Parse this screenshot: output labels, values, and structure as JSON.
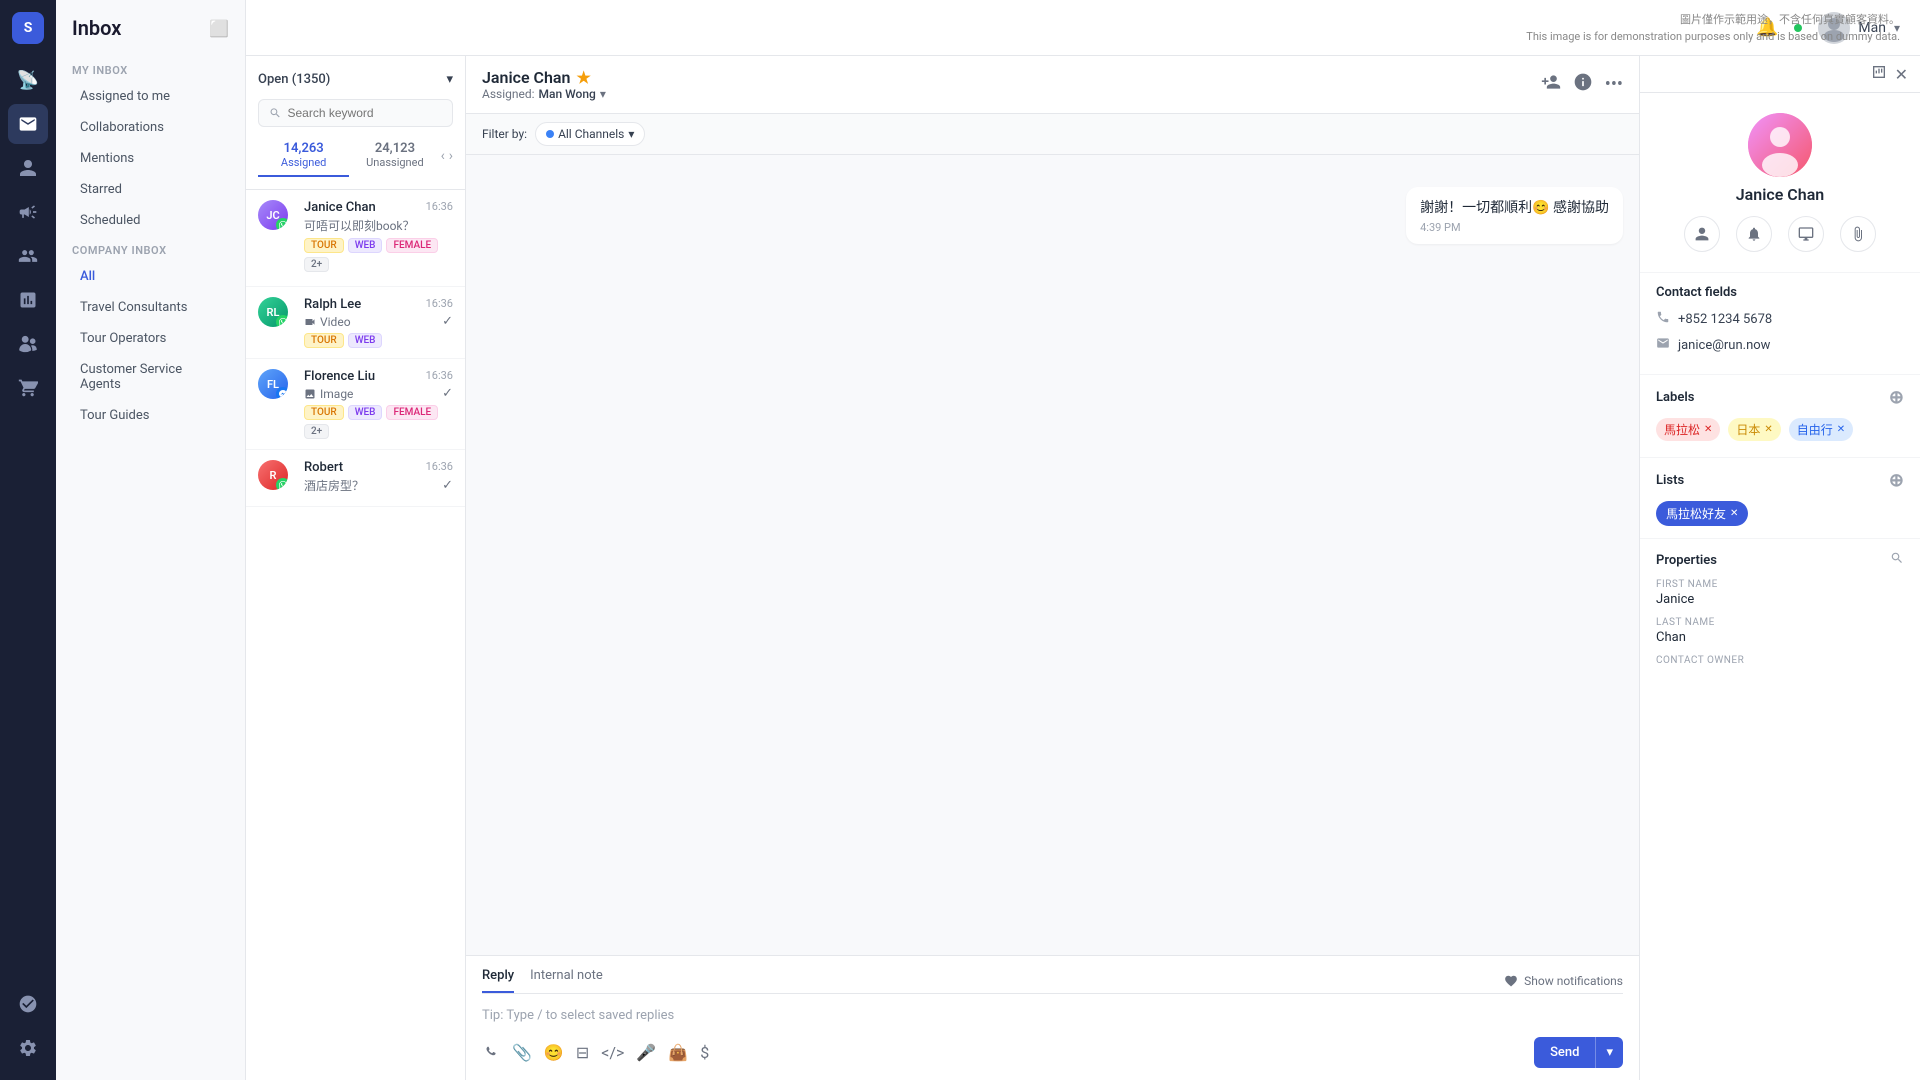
{
  "watermark": {
    "line1": "圖片僅作示範用途，不含任何真實顧客資料。",
    "line2": "This image is for demonstration purposes only and is based on dummy data."
  },
  "iconBar": {
    "logo": "S",
    "items": [
      {
        "name": "broadcast-icon",
        "icon": "📡"
      },
      {
        "name": "inbox-icon",
        "icon": "💬",
        "active": true
      },
      {
        "name": "contacts-icon",
        "icon": "👤"
      },
      {
        "name": "campaigns-icon",
        "icon": "📢"
      },
      {
        "name": "team-icon",
        "icon": "👥"
      },
      {
        "name": "reports-icon",
        "icon": "📊"
      },
      {
        "name": "integrations-icon",
        "icon": "🔧"
      },
      {
        "name": "orders-icon",
        "icon": "🛒"
      }
    ],
    "bottom": [
      {
        "name": "agents-icon",
        "icon": "👥"
      },
      {
        "name": "settings-icon",
        "icon": "⚙️"
      }
    ]
  },
  "sidebar": {
    "title": "Inbox",
    "squareIcon": "⬜",
    "myInboxLabel": "MY INBOX",
    "myInboxItems": [
      {
        "label": "Assigned to me"
      },
      {
        "label": "Collaborations"
      },
      {
        "label": "Mentions"
      },
      {
        "label": "Starred"
      },
      {
        "label": "Scheduled"
      }
    ],
    "companyInboxLabel": "COMPANY INBOX",
    "companyInboxItems": [
      {
        "label": "All",
        "active": true
      },
      {
        "label": "Travel Consultants"
      },
      {
        "label": "Tour Operators"
      },
      {
        "label": "Customer Service Agents"
      },
      {
        "label": "Tour Guides"
      }
    ]
  },
  "header": {
    "bellIcon": "🔔",
    "onlineDot": true,
    "userName": "Man",
    "chevronIcon": "▾"
  },
  "convList": {
    "dropdownLabel": "Open (1350)",
    "searchPlaceholder": "Search keyword",
    "tabs": [
      {
        "label": "Assigned",
        "count": "14,263",
        "active": true
      },
      {
        "label": "Unassigned",
        "count": "24,123"
      }
    ],
    "conversations": [
      {
        "name": "Janice Chan",
        "time": "16:36",
        "preview": "可唔可以即刻book？",
        "tags": [
          "TOUR",
          "WEB",
          "FEMALE",
          "2+"
        ],
        "avatarColor": "avatar-circle-1",
        "badgeType": "wa"
      },
      {
        "name": "Ralph Lee",
        "time": "16:36",
        "preview": "Video",
        "previewIcon": "video",
        "hasCheck": true,
        "tags": [
          "TOUR",
          "WEB"
        ],
        "avatarColor": "avatar-circle-2",
        "badgeType": "wa"
      },
      {
        "name": "Florence Liu",
        "time": "16:36",
        "preview": "Image",
        "previewIcon": "image",
        "hasCheck": true,
        "tags": [
          "TOUR",
          "WEB",
          "FEMALE",
          "2+"
        ],
        "avatarColor": "avatar-circle-3",
        "badgeType": "messenger"
      },
      {
        "name": "Robert",
        "time": "16:36",
        "preview": "酒店房型？",
        "hasCheck": true,
        "tags": [],
        "avatarColor": "avatar-circle-4",
        "badgeType": "wa"
      }
    ]
  },
  "chat": {
    "contactName": "Janice Chan",
    "starIcon": "★",
    "assignedLabel": "Assigned:",
    "assignedTo": "Man Wong",
    "chevronIcon": "▾",
    "filterLabel": "Filter by:",
    "allChannelsLabel": "All Channels",
    "message": {
      "text": "謝謝！一切都順利😊 感謝協助",
      "time": "4:39 PM"
    },
    "replyTab": "Reply",
    "internalNoteTab": "Internal note",
    "showNotifications": "Show notifications",
    "replyPlaceholder": "Tip: Type / to select saved replies",
    "sendLabel": "Send"
  },
  "contact": {
    "name": "Janice Chan",
    "phone": "+852 1234 5678",
    "email": "janice@run.now",
    "contactFieldsLabel": "Contact fields",
    "labelsLabel": "Labels",
    "labels": [
      {
        "text": "馬拉松",
        "color": "label-red"
      },
      {
        "text": "日本",
        "color": "label-yellow"
      },
      {
        "text": "自由行",
        "color": "label-blue"
      }
    ],
    "listsLabel": "Lists",
    "listItem": "馬拉松好友",
    "propertiesLabel": "Properties",
    "searchIcon": "🔍",
    "firstName": "Janice",
    "lastName": "Chan",
    "firstNameLabel": "FIRST NAME",
    "lastNameLabel": "LAST NAME",
    "contactOwnerLabel": "CONTACT OWNER"
  }
}
